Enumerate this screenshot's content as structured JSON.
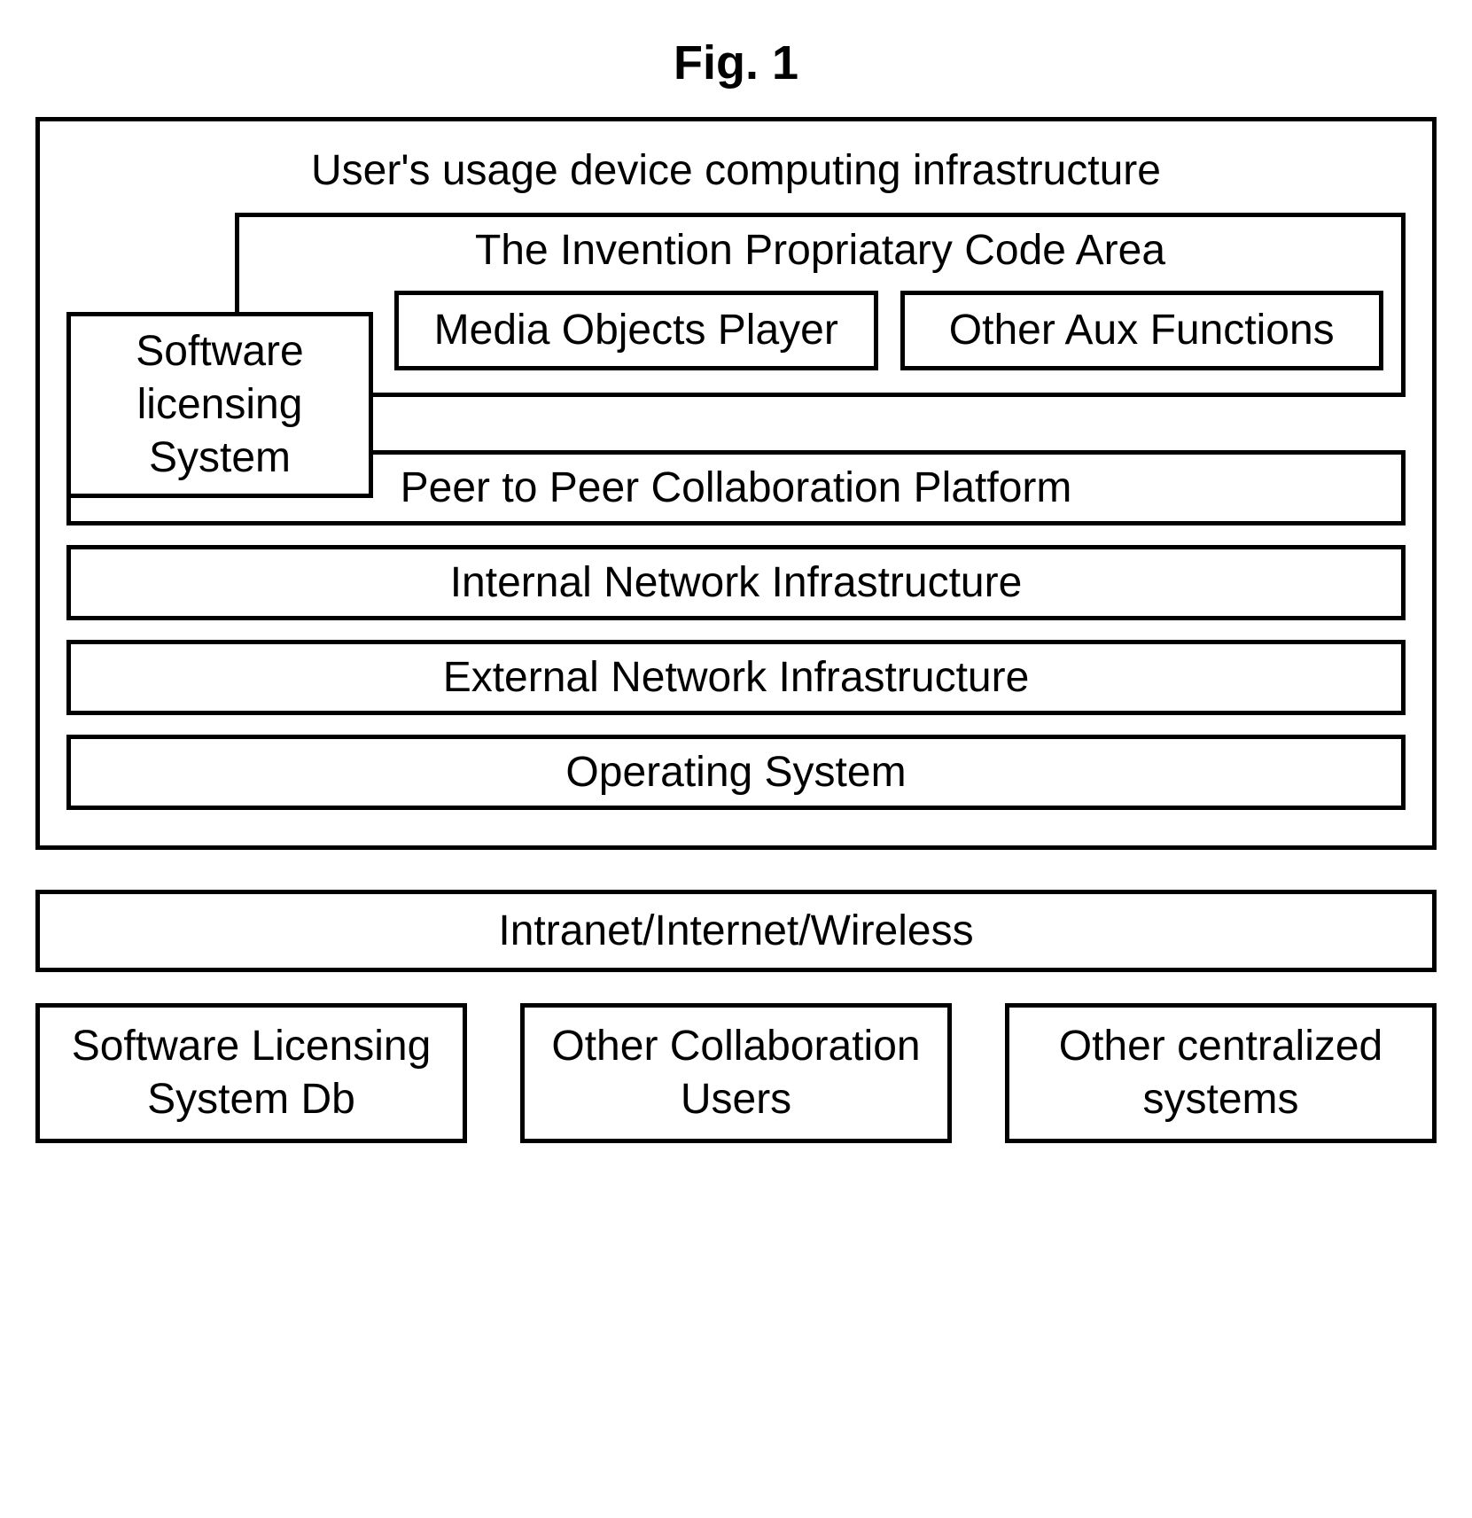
{
  "caption": "Fig. 1",
  "outer": {
    "title": "User's usage device computing infrastructure",
    "code_area_title": "The Invention Propriatary Code Area",
    "sw_licensing": "Software licensing System",
    "media_player": "Media Objects Player",
    "other_aux": "Other Aux Functions",
    "layers": {
      "p2p": "Peer to Peer Collaboration Platform",
      "internal_net": "Internal Network Infrastructure",
      "external_net": "External Network Infrastructure",
      "os": "Operating System"
    }
  },
  "network_bar": "Intranet/Internet/Wireless",
  "bottom": {
    "sw_db": "Software Licensing System Db",
    "collab_users": "Other Collaboration Users",
    "centralized": "Other centralized systems"
  }
}
